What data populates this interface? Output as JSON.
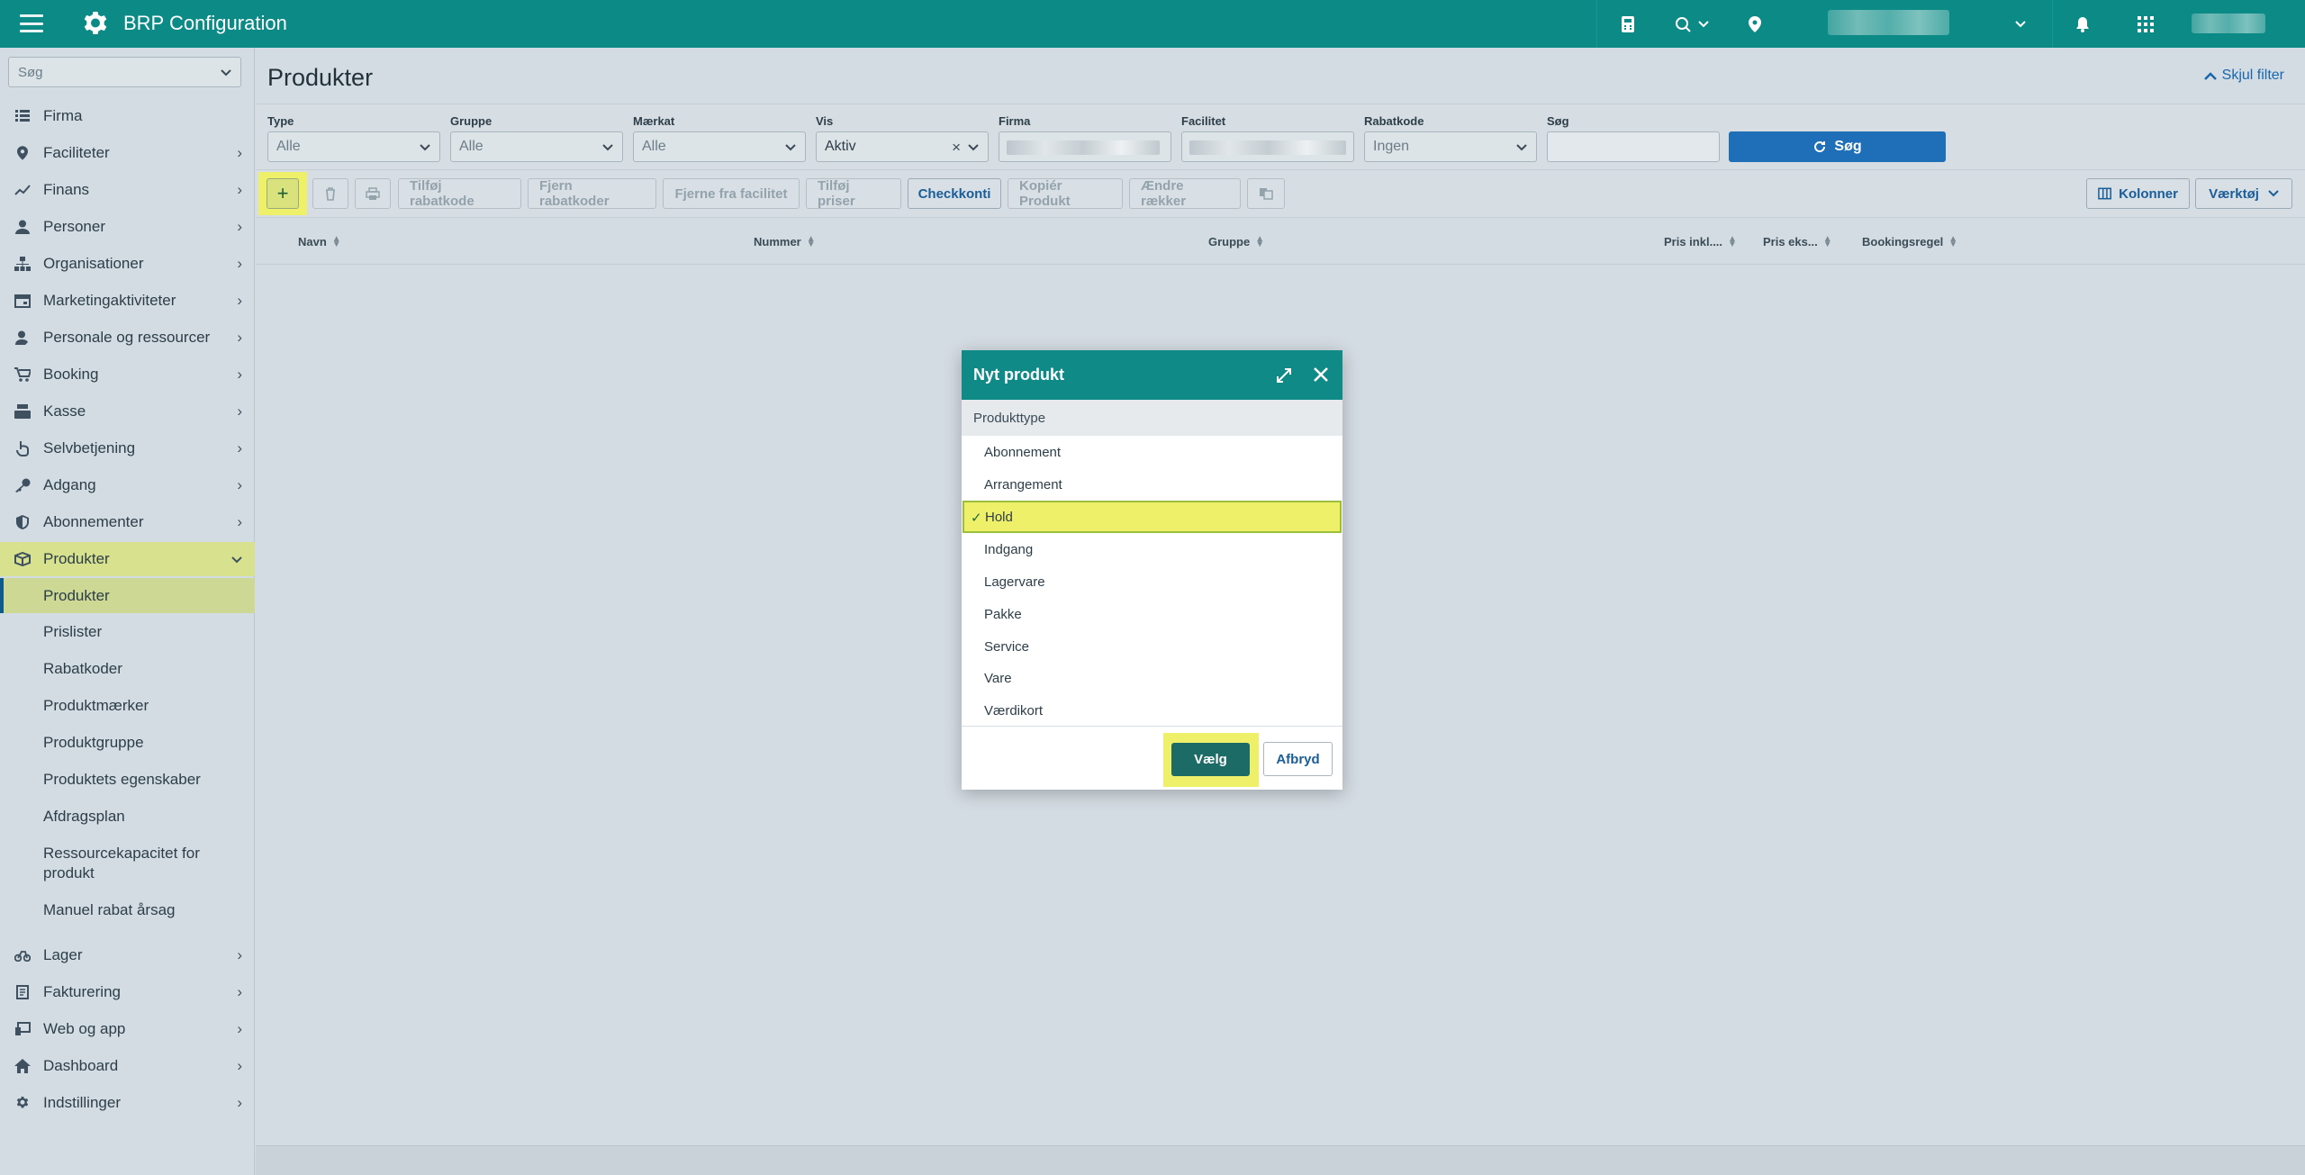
{
  "topbar": {
    "title": "BRP Configuration",
    "icons": [
      "menu-icon",
      "gear-icon",
      "calculator-icon",
      "location-search-icon",
      "map-pin-icon",
      "bell-icon",
      "apps-grid-icon"
    ]
  },
  "sidebar": {
    "search_placeholder": "Søg",
    "items": [
      {
        "label": "Firma",
        "icon": "list-icon"
      },
      {
        "label": "Faciliteter",
        "icon": "map-pin-icon"
      },
      {
        "label": "Finans",
        "icon": "trend-icon"
      },
      {
        "label": "Personer",
        "icon": "person-icon"
      },
      {
        "label": "Organisationer",
        "icon": "org-chart-icon"
      },
      {
        "label": "Marketingaktiviteter",
        "icon": "calendar-icon"
      },
      {
        "label": "Personale og ressourcer",
        "icon": "staff-icon"
      },
      {
        "label": "Booking",
        "icon": "cart-icon"
      },
      {
        "label": "Kasse",
        "icon": "register-icon"
      },
      {
        "label": "Selvbetjening",
        "icon": "hand-icon"
      },
      {
        "label": "Adgang",
        "icon": "key-icon"
      },
      {
        "label": "Abonnementer",
        "icon": "shield-icon"
      },
      {
        "label": "Produkter",
        "icon": "box-icon"
      }
    ],
    "sub_items": [
      "Produkter",
      "Prislister",
      "Rabatkoder",
      "Produktmærker",
      "Produktgruppe",
      "Produktets egenskaber",
      "Afdragsplan",
      "Ressourcekapacitet for",
      "produkt",
      "Manuel rabat årsag"
    ],
    "bottom_items": [
      {
        "label": "Lager",
        "icon": "bike-icon"
      },
      {
        "label": "Fakturering",
        "icon": "invoice-icon"
      },
      {
        "label": "Web og app",
        "icon": "devices-icon"
      },
      {
        "label": "Dashboard",
        "icon": "home-icon"
      },
      {
        "label": "Indstillinger",
        "icon": "settings-icon"
      }
    ]
  },
  "main": {
    "title": "Produkter",
    "hide_filter": "Skjul filter",
    "filters": {
      "type": {
        "label": "Type",
        "value": "Alle"
      },
      "gruppe": {
        "label": "Gruppe",
        "value": "Alle"
      },
      "maerkat": {
        "label": "Mærkat",
        "value": "Alle"
      },
      "vis": {
        "label": "Vis",
        "value": "Aktiv"
      },
      "firma": {
        "label": "Firma"
      },
      "facilitet": {
        "label": "Facilitet"
      },
      "rabatkode": {
        "label": "Rabatkode",
        "value": "Ingen"
      },
      "sog": {
        "label": "Søg",
        "value": ""
      },
      "search_button": "Søg"
    },
    "toolbar": {
      "add": "+",
      "tilfoj_rabatkode": "Tilføj rabatkode",
      "fjern_rabatkoder": "Fjern rabatkoder",
      "fjerne_fra_facilitet": "Fjerne fra facilitet",
      "tilfoj_priser": "Tilføj priser",
      "checkkonti": "Checkkonti",
      "kopier_produkt": "Kopiér Produkt",
      "aendre_raekker": "Ændre rækker",
      "kolonner": "Kolonner",
      "vaerktoj": "Værktøj"
    },
    "columns": [
      "Navn",
      "Nummer",
      "Gruppe",
      "Pris inkl....",
      "Pris eks...",
      "Bookingsregel"
    ]
  },
  "modal": {
    "title": "Nyt produkt",
    "section": "Produkttype",
    "options": [
      "Abonnement",
      "Arrangement",
      "Hold",
      "Indgang",
      "Lagervare",
      "Pakke",
      "Service",
      "Vare",
      "Værdikort"
    ],
    "selected": "Hold",
    "confirm": "Vælg",
    "cancel": "Afbryd"
  },
  "colors": {
    "header_teal": "#0b8a86",
    "highlight_yellow": "#eef06a",
    "primary_blue": "#1e6fb8"
  }
}
